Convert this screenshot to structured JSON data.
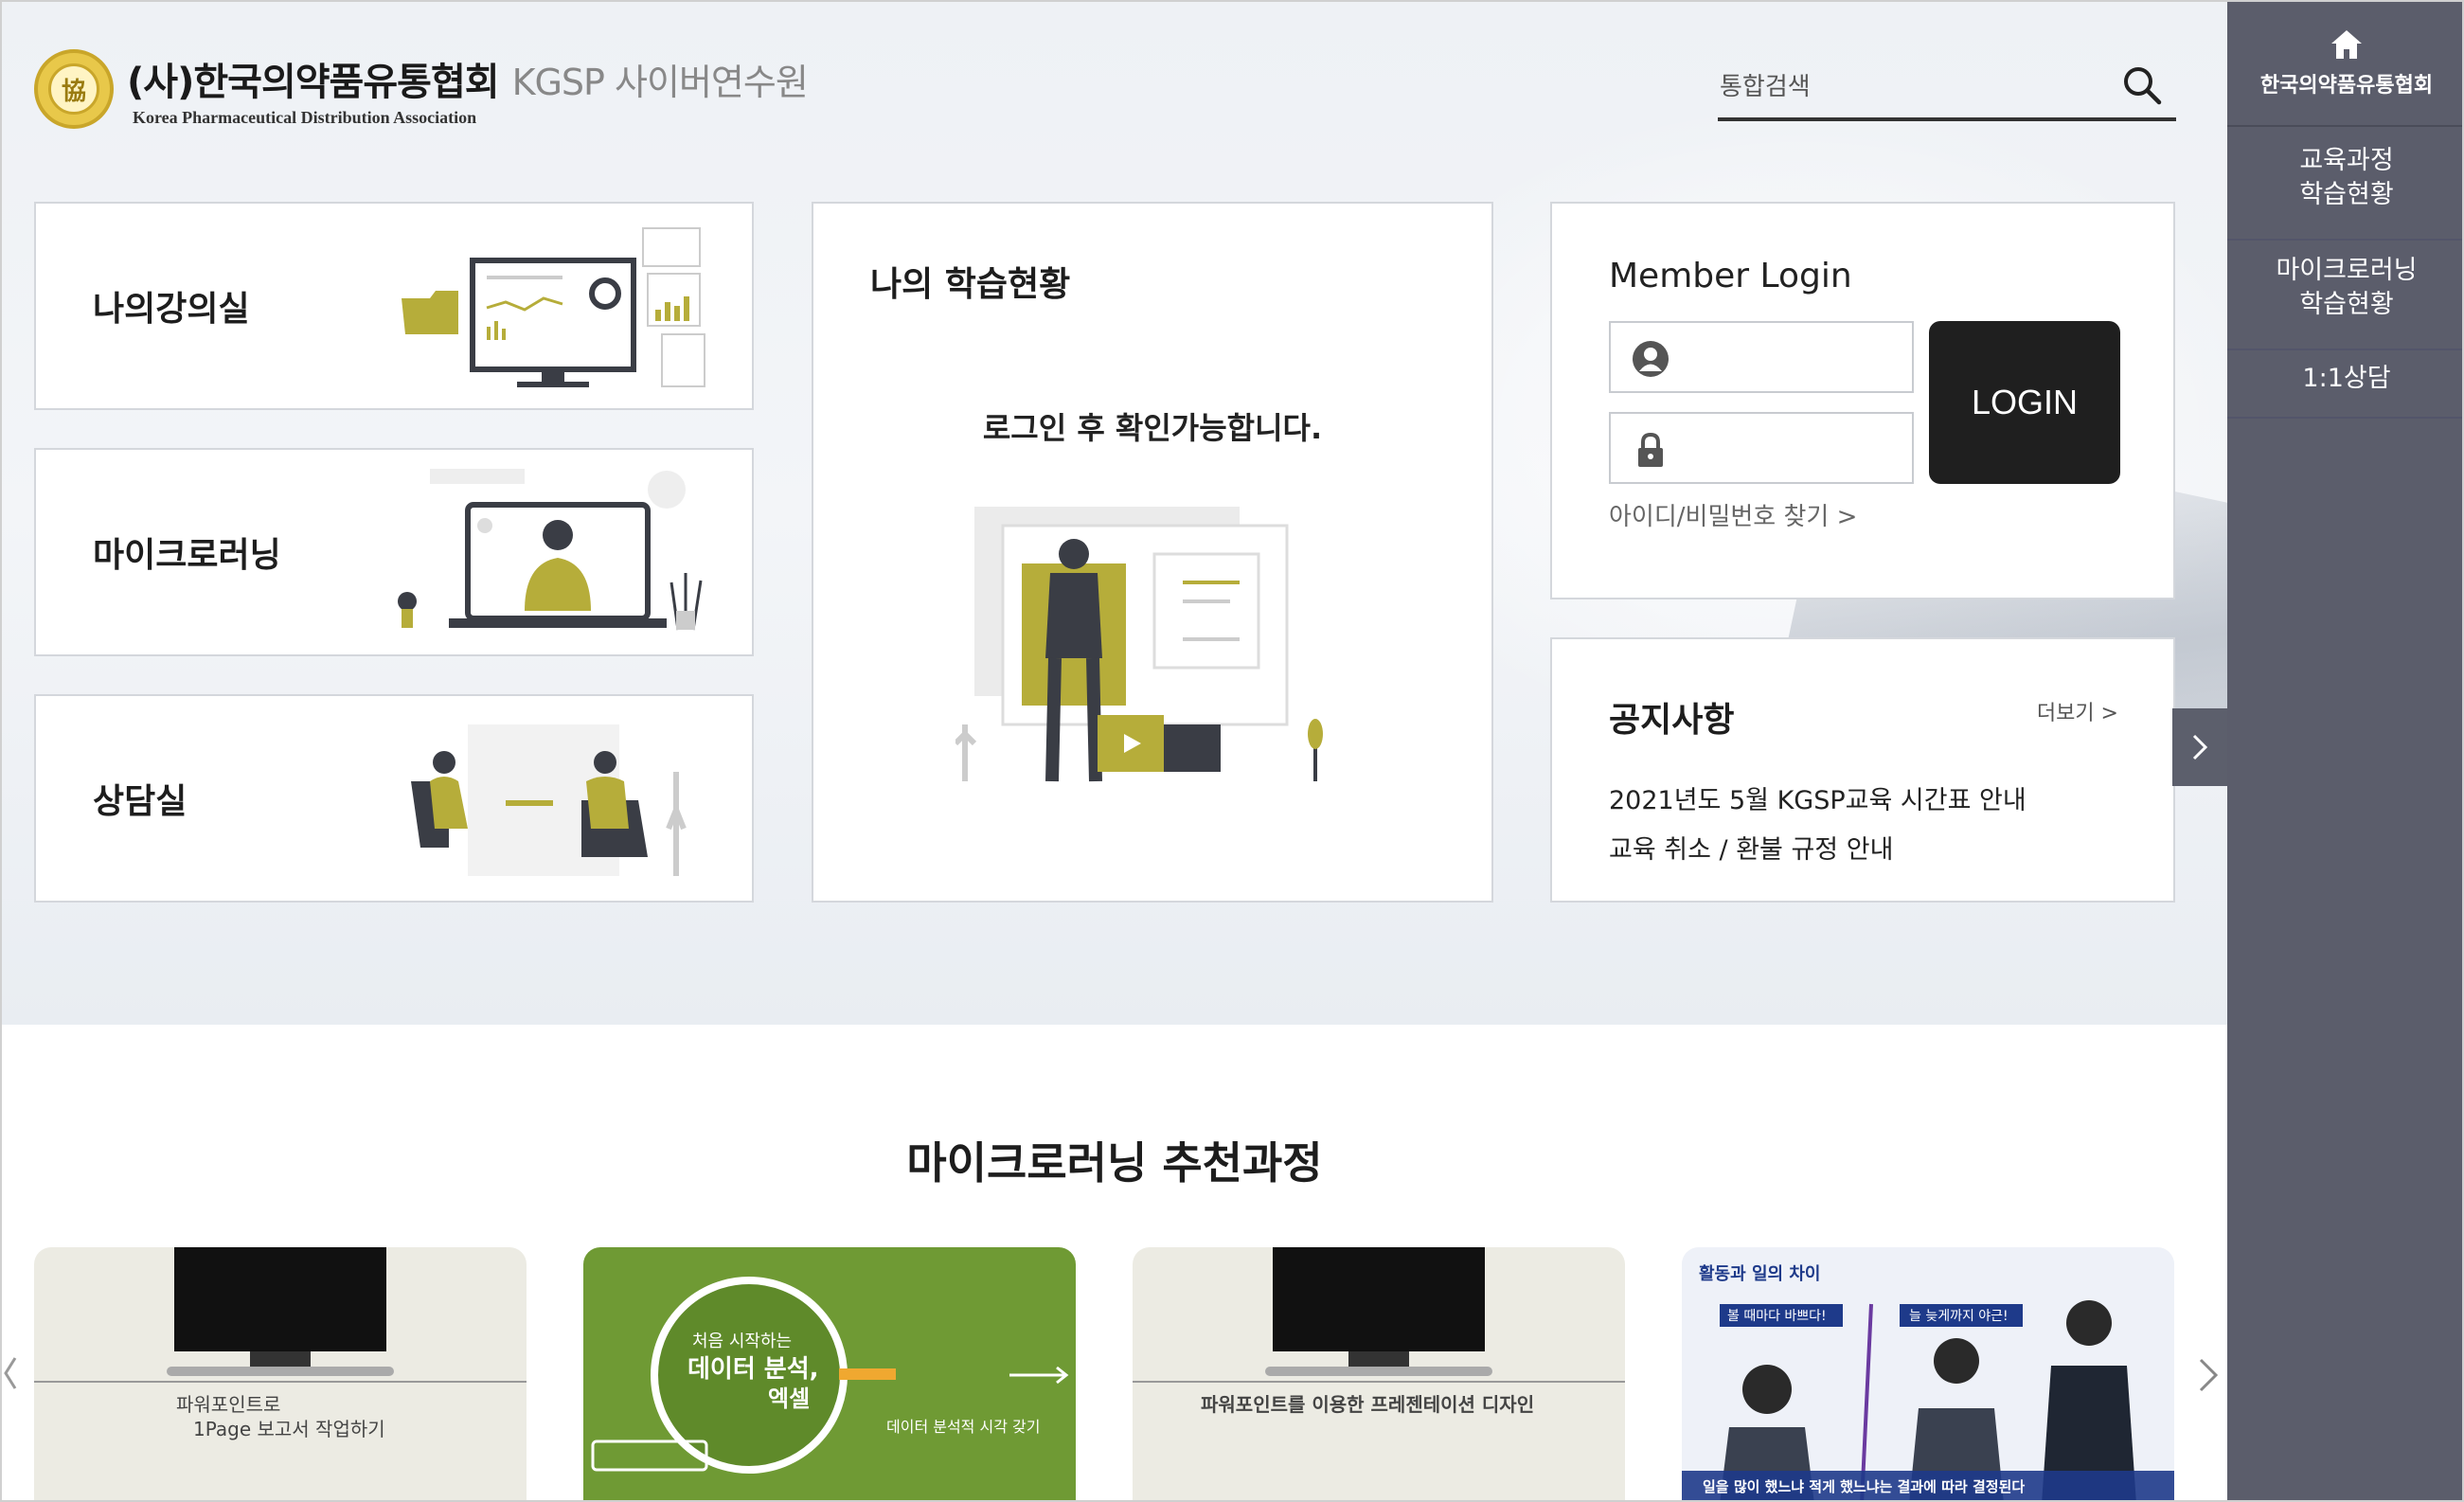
{
  "header": {
    "org_name": "(사)한국의약품유통협회",
    "site_name": "KGSP 사이버연수원",
    "org_name_en": "Korea Pharmaceutical Distribution Association",
    "search_placeholder": "통합검색"
  },
  "menu_cards": [
    {
      "label": "나의강의실"
    },
    {
      "label": "마이크로러닝"
    },
    {
      "label": "상담실"
    }
  ],
  "study_status": {
    "title": "나의 학습현황",
    "message": "로그인 후 확인가능합니다."
  },
  "login": {
    "title": "Member Login",
    "button": "LOGIN",
    "find_link": "아이디/비밀번호 찾기 >"
  },
  "notice": {
    "title": "공지사항",
    "more": "더보기 >",
    "items": [
      "2021년도 5월 KGSP교육 시간표 안내",
      "교육 취소 / 환불 규정 안내"
    ]
  },
  "right_nav": {
    "home_label": "한국의약품유통협회",
    "items": [
      {
        "line1": "교육과정",
        "line2": "학습현황"
      },
      {
        "line1": "마이크로러닝",
        "line2": "학습현황"
      },
      {
        "line1": "1:1상담",
        "line2": ""
      }
    ]
  },
  "recommended": {
    "title": "마이크로러닝 추천과정",
    "courses": [
      {
        "line1": "파워포인트로",
        "line2": "1Page 보고서 작업하기"
      },
      {
        "line1": "처음 시작하는",
        "line2": "데이터 분석,",
        "line3": "엑셀",
        "caption": "데이터 분석적 시각 갖기"
      },
      {
        "line1": "파워포인트를 이용한 프레젠테이션 디자인"
      },
      {
        "line1": "활동과 일의 차이",
        "badge1": "볼 때마다 바쁘다!",
        "badge2": "늘 늦게까지 야근!",
        "caption": "일을 많이 했느냐 적게 했느냐는 결과에 따라 결정된다"
      }
    ]
  },
  "colors": {
    "accent_olive": "#b6ad3a",
    "nav_bg": "#5b5d6b",
    "login_btn": "#1f1f1f"
  }
}
